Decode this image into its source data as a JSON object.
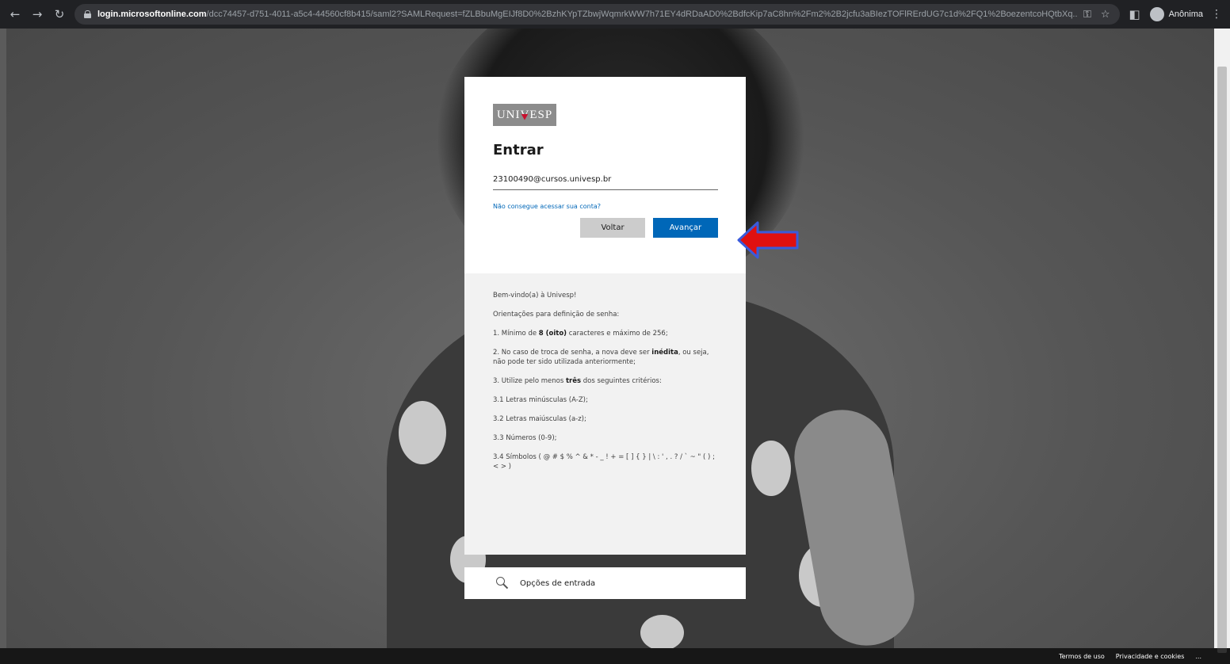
{
  "browser": {
    "back_icon": "back-arrow-icon",
    "forward_icon": "forward-arrow-icon",
    "reload_icon": "reload-icon",
    "url_host": "login.microsoftonline.com",
    "url_path": "/dcc74457-d751-4011-a5c4-44560cf8b415/saml2?SAMLRequest=fZLBbuMgEIJf8D0%2BzhKYpTZbwjWqmrkWW7h71EY4dRDaAD0%2BdfcKip7aC8hn%2Fm2%2B2jcfu3aBIezTOFlRErdUG7c1d%2FQ1%2BoezentcoHQtbXq...",
    "profile_name": "Anônima"
  },
  "card": {
    "logo_text_left": "UNI",
    "logo_text_v": "V",
    "logo_text_right": "ESP",
    "title": "Entrar",
    "email_value": "23100490@cursos.univesp.br",
    "forgot_link": "Não consegue acessar sua conta?",
    "back_button": "Voltar",
    "next_button": "Avançar"
  },
  "info": {
    "welcome": "Bem-vindo(a) à Univesp!",
    "guidelines": "Orientações para definição de senha:",
    "rule1_pre": "1. Mínimo de ",
    "rule1_bold": "8 (oito)",
    "rule1_post": " caracteres e máximo de 256;",
    "rule2_pre": "2. No caso de troca de senha, a nova deve ser ",
    "rule2_bold": "inédita",
    "rule2_post": ", ou seja, não pode ter sido utilizada anteriormente;",
    "rule3_pre": "3. Utilize pelo menos ",
    "rule3_bold": "três",
    "rule3_post": " dos seguintes critérios:",
    "rule31": "3.1 Letras minúsculas (A-Z);",
    "rule32": "3.2 Letras maiúsculas (a-z);",
    "rule33": "3.3 Números (0-9);",
    "rule34": "3.4 Símbolos ( @ # $ % ^ & * - _ ! + = [ ] { } | \\ : ' , . ? / ` ~ \" ( ) ; < > )"
  },
  "options": {
    "label": "Opções de entrada",
    "icon": "key-icon"
  },
  "footer": {
    "terms": "Termos de uso",
    "privacy": "Privacidade e cookies",
    "more": "..."
  },
  "colors": {
    "accent": "#0067b8",
    "annotation_arrow": "#e01010",
    "annotation_arrow_outline": "#3b5bdb"
  }
}
